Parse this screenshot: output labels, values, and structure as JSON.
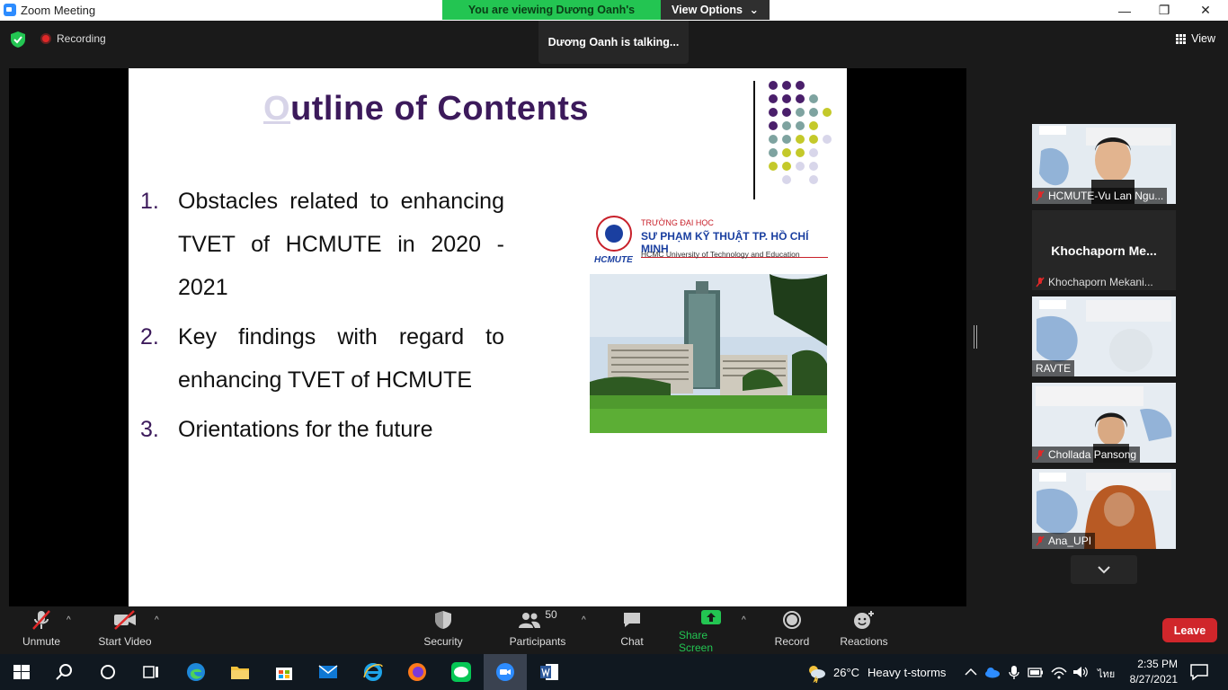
{
  "window": {
    "title": "Zoom Meeting",
    "minimize": "—",
    "maximize": "❐",
    "close": "✕"
  },
  "banner": {
    "viewing": "You are viewing Dương Oanh's screen",
    "view_options": "View Options",
    "chevron": "⌄"
  },
  "topbar": {
    "recording": "Recording",
    "talking": "Dương Oanh is talking...",
    "view": "View"
  },
  "slide": {
    "title_first": "O",
    "title_rest": "utline of Contents",
    "items": [
      {
        "num": "1.",
        "text": "Obstacles related to enhancing TVET of HCMUTE in 2020 - 2021"
      },
      {
        "num": "2.",
        "text": "Key findings with regard to enhancing TVET of HCMUTE"
      },
      {
        "num": "3.",
        "text": "Orientations for the future"
      }
    ],
    "logo": {
      "line1": "TRƯỜNG ĐẠI HỌC",
      "line2": "SƯ PHẠM KỸ THUẬT TP. HỒ CHÍ MINH",
      "line3": "HCMC University of Technology and Education",
      "brand": "HCMUTE"
    }
  },
  "participants_panel": {
    "tiles": [
      {
        "name": "HCMUTE-Vu Lan Ngu...",
        "muted": true
      },
      {
        "name": "Khochaporn Mekani...",
        "display": "Khochaporn  Me...",
        "muted": true
      },
      {
        "name": "RAVTE",
        "muted": false
      },
      {
        "name": "Chollada Pansong",
        "muted": true
      },
      {
        "name": "Ana_UPI",
        "muted": true
      }
    ],
    "more": "⌄"
  },
  "toolbar": {
    "unmute": "Unmute",
    "start_video": "Start Video",
    "security": "Security",
    "participants": "Participants",
    "participants_count": "50",
    "chat": "Chat",
    "share_screen": "Share Screen",
    "record": "Record",
    "reactions": "Reactions",
    "leave": "Leave",
    "caret": "^"
  },
  "taskbar": {
    "weather_temp": "26°C",
    "weather_desc": "Heavy t-storms",
    "lang": "ไทย",
    "time": "2:35 PM",
    "date": "8/27/2021"
  },
  "colors": {
    "slide_title": "#3c1a5b",
    "banner_green": "#23c552",
    "leave_red": "#d0262b",
    "share_green": "#23c552"
  }
}
